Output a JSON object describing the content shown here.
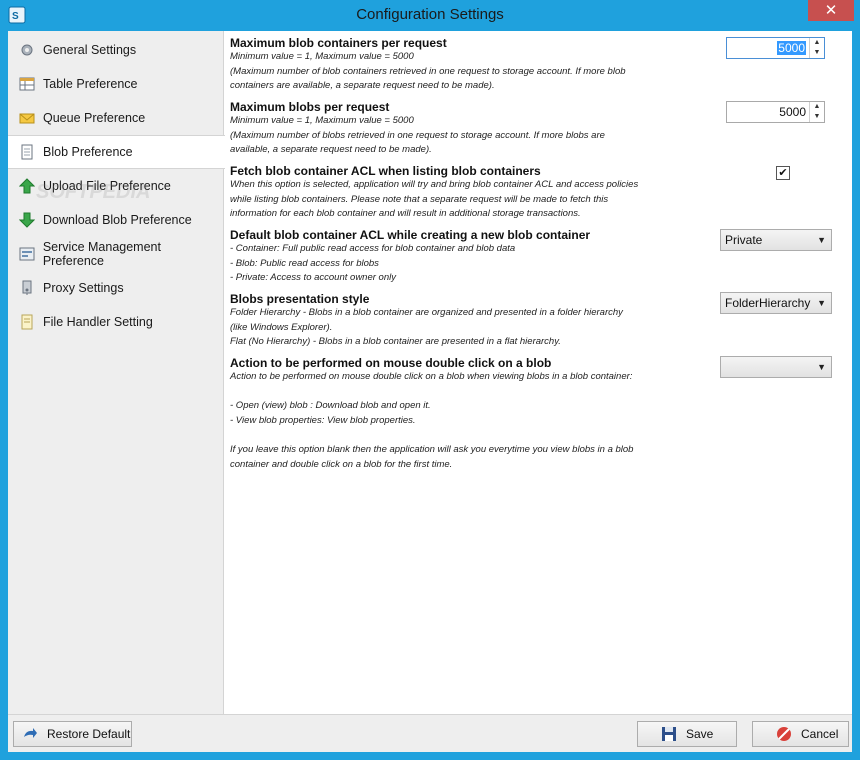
{
  "window": {
    "title": "Configuration Settings",
    "close_glyph": "✕"
  },
  "sidebar": {
    "items": [
      {
        "label": "General Settings",
        "icon": "gear-icon"
      },
      {
        "label": "Table Preference",
        "icon": "table-icon"
      },
      {
        "label": "Queue Preference",
        "icon": "envelope-icon"
      },
      {
        "label": "Blob Preference",
        "icon": "document-icon",
        "active": true
      },
      {
        "label": "Upload File Preference",
        "icon": "upload-arrow-icon"
      },
      {
        "label": "Download Blob Preference",
        "icon": "download-arrow-icon"
      },
      {
        "label": "Service Management Preference",
        "icon": "service-icon"
      },
      {
        "label": "Proxy Settings",
        "icon": "proxy-icon"
      },
      {
        "label": "File Handler Setting",
        "icon": "file-icon"
      }
    ]
  },
  "settings": [
    {
      "label": "Maximum blob containers per request",
      "desc": "Minimum value = 1, Maximum value = 5000\n(Maximum number of blob containers retrieved in one request to storage account. If more blob\ncontainers are available, a separate request need to be made).",
      "value": "5000"
    },
    {
      "label": "Maximum blobs per request",
      "desc": "Minimum value = 1, Maximum value = 5000\n(Maximum number of blobs retrieved in one request to storage account. If more blobs are\navailable, a separate request need to be made).",
      "value": "5000"
    },
    {
      "label": "Fetch blob container ACL when listing blob containers",
      "desc": "When this option is selected, application will try and bring blob container ACL and access policies\nwhile listing blob containers. Please note that a separate request will be made to fetch this\ninformation for each blob container and will result in additional storage transactions.",
      "checked_glyph": "✔"
    },
    {
      "label": "Default blob container ACL while creating a new blob container",
      "desc": "- Container: Full public read access for blob container and blob data\n- Blob: Public read access for blobs\n- Private: Access to account owner only",
      "value": "Private"
    },
    {
      "label": "Blobs presentation style",
      "desc": "Folder Hierarchy - Blobs in a blob container are organized and presented in a folder hierarchy\n(like Windows Explorer).\nFlat (No Hierarchy) - Blobs in a blob container are presented in a flat hierarchy.",
      "value": "FolderHierarchy"
    },
    {
      "label": "Action to be performed on mouse double click on a blob",
      "desc": "Action to be performed on mouse double click on a blob when viewing blobs in a blob container:\n\n- Open (view) blob : Download blob and open it.\n- View blob properties: View blob properties.\n\nIf you leave this option blank then the application will ask you everytime you view blobs in a blob\ncontainer and double click on a blob for the first time.",
      "value": ""
    }
  ],
  "footer": {
    "restore_label": "Restore Default",
    "save_label": "Save",
    "cancel_label": "Cancel"
  },
  "glyphs": {
    "up": "▲",
    "down": "▼"
  },
  "watermark": "SOFTPEDIA",
  "colors": {
    "titlebar": "#1fa1dd",
    "close": "#c7504f",
    "selection": "#3399ff"
  }
}
